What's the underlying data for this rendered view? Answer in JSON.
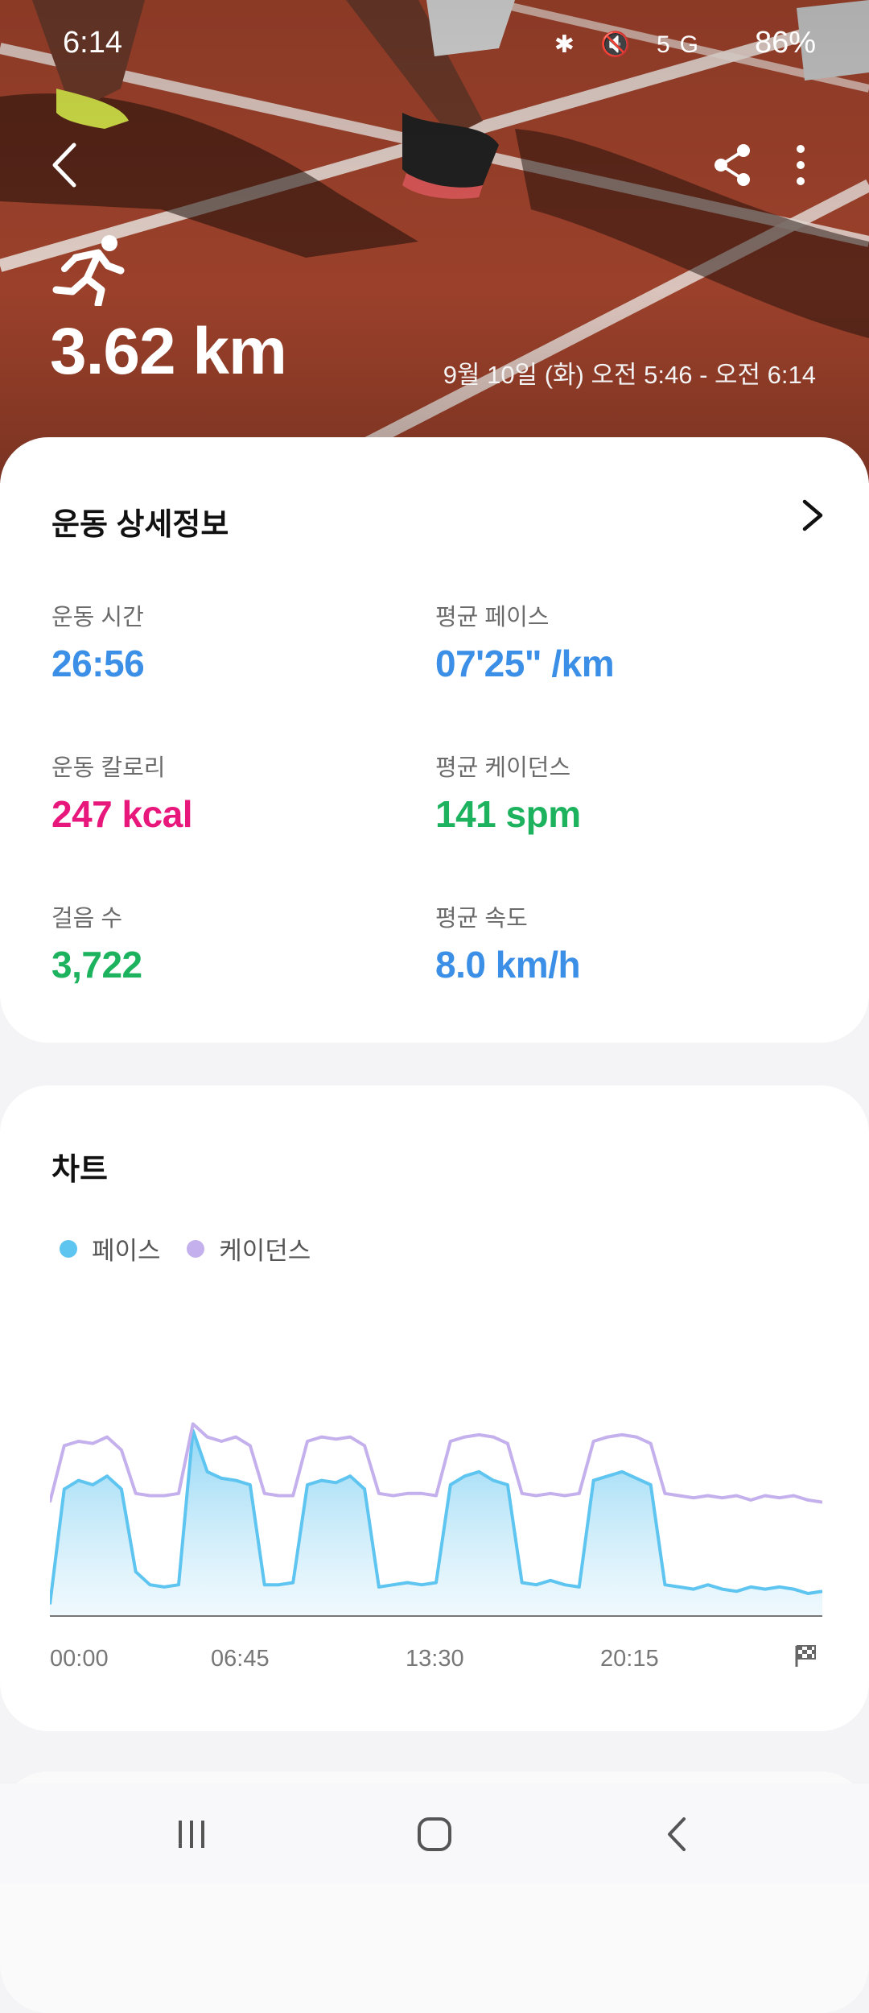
{
  "status_bar": {
    "time": "6:14",
    "battery": "86%",
    "network": "5G"
  },
  "hero": {
    "distance": "3.62 km",
    "date_range": "9월 10일 (화) 오전 5:46 - 오전 6:14",
    "icons": [
      "back-icon",
      "share-icon",
      "more-vert-icon",
      "running-icon"
    ]
  },
  "details": {
    "title": "운동 상세정보",
    "metrics": {
      "duration": {
        "label": "운동 시간",
        "value": "26:56",
        "color": "#3b8fe6"
      },
      "avg_pace": {
        "label": "평균 페이스",
        "value": "07'25\" /km",
        "color": "#3b8fe6"
      },
      "calories": {
        "label": "운동 칼로리",
        "value": "247 kcal",
        "color": "#e8177c"
      },
      "avg_cadence": {
        "label": "평균 케이던스",
        "value": "141 spm",
        "color": "#1db35e"
      },
      "steps": {
        "label": "걸음 수",
        "value": "3,722",
        "color": "#1db35e"
      },
      "avg_speed": {
        "label": "평균 속도",
        "value": "8.0 km/h",
        "color": "#3b8fe6"
      }
    }
  },
  "chart": {
    "title": "차트",
    "legend": [
      {
        "name": "페이스",
        "color": "#5ec4f0"
      },
      {
        "name": "케이던스",
        "color": "#c4b0ec"
      }
    ],
    "x_labels": [
      "00:00",
      "06:45",
      "13:30",
      "20:15"
    ]
  },
  "chart_data": {
    "type": "area",
    "x": [
      0.0,
      0.5,
      1.0,
      1.5,
      2.0,
      2.5,
      3.0,
      3.5,
      4.0,
      4.5,
      5.0,
      5.5,
      6.0,
      6.5,
      7.0,
      7.5,
      8.0,
      8.5,
      9.0,
      9.5,
      10.0,
      10.5,
      11.0,
      11.5,
      12.0,
      12.5,
      13.0,
      13.5,
      14.0,
      14.5,
      15.0,
      15.5,
      16.0,
      16.5,
      17.0,
      17.5,
      18.0,
      18.5,
      19.0,
      19.5,
      20.0,
      20.5,
      21.0,
      21.5,
      22.0,
      22.5,
      23.0,
      23.5,
      24.0,
      24.5,
      25.0,
      25.5,
      26.0,
      26.5,
      27.0
    ],
    "x_label_values": [
      "00:00",
      "06:45",
      "13:30",
      "20:15"
    ],
    "series": [
      {
        "name": "페이스",
        "color": "#5ec4f0",
        "values": [
          0.05,
          0.58,
          0.62,
          0.6,
          0.64,
          0.58,
          0.2,
          0.14,
          0.13,
          0.14,
          0.85,
          0.66,
          0.63,
          0.62,
          0.6,
          0.14,
          0.14,
          0.15,
          0.6,
          0.62,
          0.61,
          0.64,
          0.58,
          0.13,
          0.14,
          0.15,
          0.14,
          0.15,
          0.6,
          0.64,
          0.66,
          0.62,
          0.6,
          0.15,
          0.14,
          0.16,
          0.14,
          0.13,
          0.62,
          0.64,
          0.66,
          0.63,
          0.6,
          0.14,
          0.13,
          0.12,
          0.14,
          0.12,
          0.11,
          0.13,
          0.12,
          0.13,
          0.12,
          0.1,
          0.11
        ]
      },
      {
        "name": "케이던스",
        "color": "#c4b0ec",
        "values": [
          0.52,
          0.78,
          0.8,
          0.79,
          0.82,
          0.76,
          0.56,
          0.55,
          0.55,
          0.56,
          0.88,
          0.82,
          0.8,
          0.82,
          0.78,
          0.56,
          0.55,
          0.55,
          0.8,
          0.82,
          0.81,
          0.82,
          0.78,
          0.56,
          0.55,
          0.56,
          0.56,
          0.55,
          0.8,
          0.82,
          0.83,
          0.82,
          0.79,
          0.56,
          0.55,
          0.56,
          0.55,
          0.56,
          0.8,
          0.82,
          0.83,
          0.82,
          0.79,
          0.56,
          0.55,
          0.54,
          0.55,
          0.54,
          0.55,
          0.53,
          0.55,
          0.54,
          0.55,
          0.53,
          0.52
        ]
      }
    ],
    "ylim": [
      0,
      1
    ],
    "grid": false,
    "legend_placement": "top-left"
  }
}
